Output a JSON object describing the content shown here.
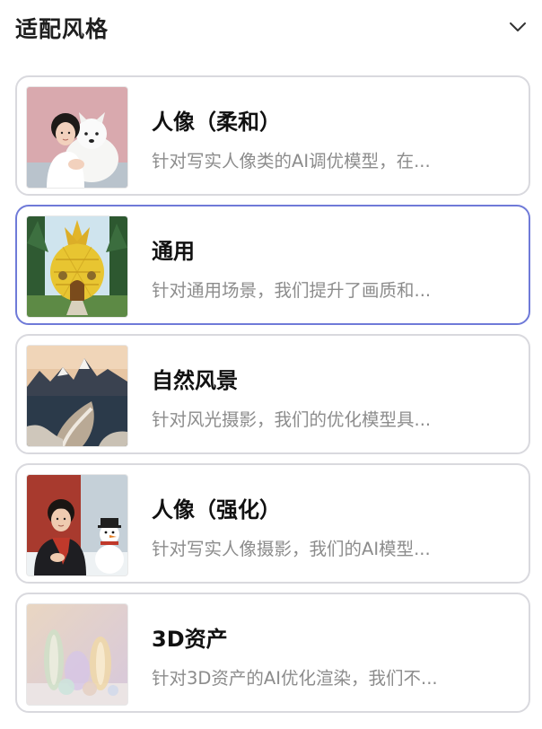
{
  "header": {
    "title": "适配风格",
    "collapse_icon": "chevron-down-icon"
  },
  "styles": [
    {
      "title": "人像（柔和）",
      "desc": "针对写实人像类的AI调优模型，在...",
      "image": "girl-with-white-dog-photo",
      "selected": false
    },
    {
      "title": "通用",
      "desc": "针对通用场景，我们提升了画质和...",
      "image": "pineapple-house-photo",
      "selected": true
    },
    {
      "title": "自然风景",
      "desc": "针对风光摄影，我们的优化模型具...",
      "image": "snowy-mountain-landscape-photo",
      "selected": false
    },
    {
      "title": "人像（强化）",
      "desc": "针对写实人像摄影，我们的AI模型...",
      "image": "boy-with-snowman-photo",
      "selected": false
    },
    {
      "title": "3D资产",
      "desc": "针对3D资产的AI优化渲染，我们不...",
      "image": "glass-objects-render",
      "selected": false
    }
  ],
  "colors": {
    "selected_border": "#6f7ad8",
    "border": "#d9d9de",
    "desc_text": "#8c8c8c",
    "title_text": "#111111"
  }
}
